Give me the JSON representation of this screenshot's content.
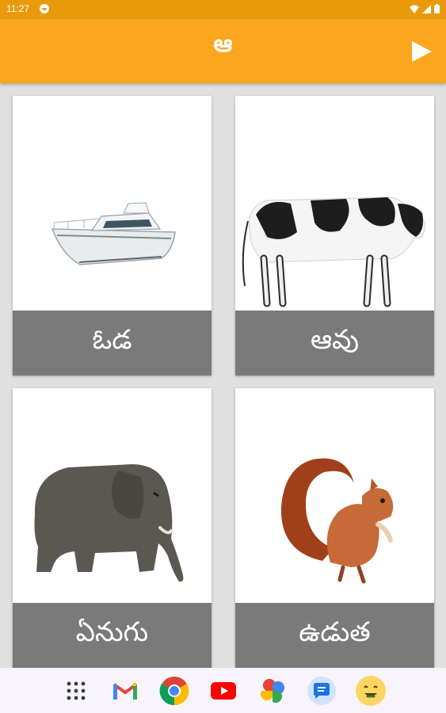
{
  "status_bar": {
    "time": "11:27"
  },
  "app_bar": {
    "title": "ఆ",
    "play_icon": "play-icon"
  },
  "cards": [
    {
      "label": "ఓడ",
      "image": "boat"
    },
    {
      "label": "ఆవు",
      "image": "cow"
    },
    {
      "label": "ఏనుగు",
      "image": "elephant"
    },
    {
      "label": "ఉడుత",
      "image": "squirrel"
    }
  ],
  "dock": {
    "apps": [
      "app-drawer-icon",
      "gmail-icon",
      "chrome-icon",
      "youtube-icon",
      "photos-icon",
      "messages-icon",
      "emoji-app-icon"
    ]
  },
  "colors": {
    "app_bar": "#fba61c",
    "status_bar": "#e89a0b",
    "label_bg": "#7a7a7a"
  }
}
